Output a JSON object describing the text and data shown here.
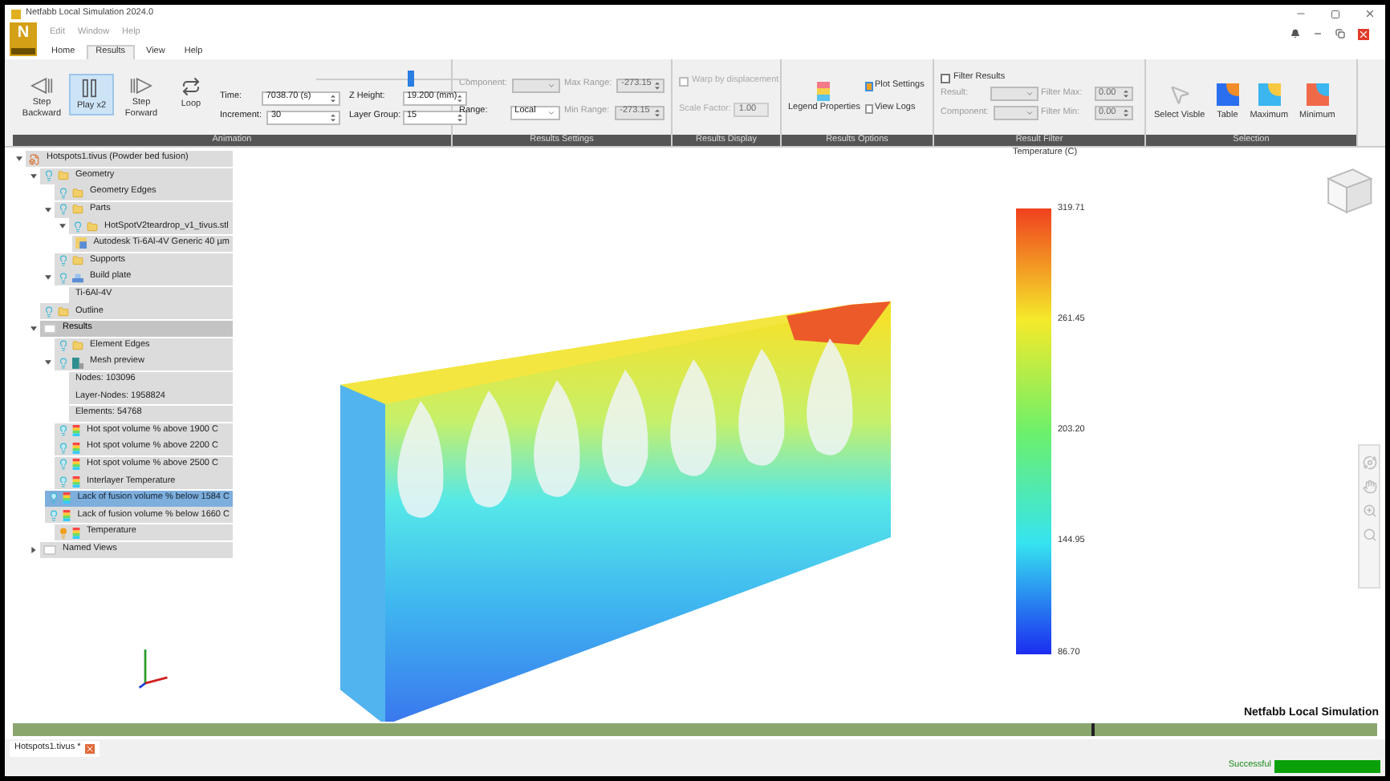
{
  "window": {
    "title": "Netfabb Local Simulation 2024.0"
  },
  "app_button": {
    "label": "N"
  },
  "menu": [
    "Edit",
    "Window",
    "Help"
  ],
  "tabs": [
    {
      "label": "Home",
      "selected": false
    },
    {
      "label": "Results",
      "selected": true
    },
    {
      "label": "View",
      "selected": false
    },
    {
      "label": "Help",
      "selected": false
    }
  ],
  "ribbon": {
    "animation": {
      "label": "Animation",
      "buttons": [
        {
          "label": "Step Backward",
          "kind": "back",
          "selected": false
        },
        {
          "label": "Play x2",
          "kind": "play",
          "selected": true
        },
        {
          "label": "Step Forward",
          "kind": "forward",
          "selected": false
        },
        {
          "label": "Loop",
          "kind": "loop",
          "selected": false
        }
      ],
      "slider": {
        "level": 0.62
      },
      "fields": [
        {
          "label": "Time:",
          "value": "7038.70 (s)"
        },
        {
          "label": "Z Height:",
          "value": "19.200 (mm)"
        },
        {
          "label": "Increment:",
          "value": "30"
        },
        {
          "label": "Layer Group:",
          "value": "15"
        }
      ]
    },
    "results_settings": {
      "label": "Results Settings",
      "fields": [
        {
          "label": "Component:",
          "kind": "select",
          "disabled": true
        },
        {
          "label": "Max Range:",
          "value": "-273.15",
          "kind": "spin",
          "disabled": true
        },
        {
          "label": "Range:",
          "value": "Local",
          "kind": "select",
          "disabled": false
        },
        {
          "label": "Min Range:",
          "value": "-273.15",
          "kind": "spin",
          "disabled": true
        }
      ]
    },
    "results_display": {
      "label": "Results Display",
      "warp": {
        "label": "Warp by displacement",
        "checked": false
      },
      "scale": {
        "label": "Scale Factor:",
        "value": "1.00"
      }
    },
    "results_options": {
      "label": "Results Options",
      "buttons": [
        {
          "label": "Legend Properties",
          "kind": "large"
        },
        {
          "label": "Plot Settings",
          "kind": "small"
        },
        {
          "label": "View Logs",
          "kind": "small"
        }
      ]
    },
    "result_filter": {
      "label": "Result Filter",
      "filter": {
        "label": "Filter Results",
        "checked": false
      },
      "fields": [
        {
          "label": "Result:",
          "kind": "select"
        },
        {
          "label": "Filter Max:",
          "value": "0.00",
          "kind": "spin"
        },
        {
          "label": "Component:",
          "kind": "select"
        },
        {
          "label": "Filter Min:",
          "value": "0.00",
          "kind": "spin"
        }
      ]
    },
    "selection": {
      "label": "Selection",
      "buttons": [
        {
          "label": "Select Visble",
          "kind": "cursor"
        },
        {
          "label": "Table",
          "kind": "table"
        },
        {
          "label": "Maximum",
          "kind": "maximum"
        },
        {
          "label": "Minimum",
          "kind": "minimum"
        }
      ]
    }
  },
  "tree": [
    {
      "label": "Hotspots1.tivus (Powder bed fusion)",
      "kind": "file",
      "expanded": true,
      "selected": false,
      "children": [
        {
          "label": "Geometry",
          "kind": "folder",
          "expanded": true,
          "selected": false,
          "children": [
            {
              "label": "Geometry Edges",
              "kind": "folder",
              "selected": false
            },
            {
              "label": "Parts",
              "kind": "folder",
              "expanded": true,
              "selected": false,
              "children": [
                {
                  "label": "HotSpotV2teardrop_v1_tivus.stl",
                  "kind": "folder",
                  "expanded": true,
                  "selected": false,
                  "children": [
                    {
                      "label": "Autodesk Ti-6Al-4V Generic 40 µm",
                      "kind": "material",
                      "selected": false
                    }
                  ]
                }
              ]
            },
            {
              "label": "Supports",
              "kind": "folder",
              "selected": false
            },
            {
              "label": "Build plate",
              "kind": "plate",
              "expanded": true,
              "selected": false,
              "children": [
                {
                  "label": "Ti-6Al-4V",
                  "kind": "property",
                  "selected": false
                }
              ]
            }
          ]
        },
        {
          "label": "Outline",
          "kind": "folder",
          "selected": false
        },
        {
          "label": "Results",
          "kind": "category",
          "expanded": true,
          "selected": false,
          "children": [
            {
              "label": "Element Edges",
              "kind": "folder",
              "selected": false
            },
            {
              "label": "Mesh preview",
              "kind": "mesh",
              "expanded": true,
              "selected": false,
              "children": [
                {
                  "label": "Nodes: 103096",
                  "kind": "property",
                  "selected": false
                },
                {
                  "label": "Layer-Nodes: 1958824",
                  "kind": "property",
                  "selected": false
                },
                {
                  "label": "Elements: 54768",
                  "kind": "property",
                  "selected": false
                }
              ]
            },
            {
              "label": "Hot spot volume % above 1900 C",
              "kind": "result",
              "active": false,
              "selected": false
            },
            {
              "label": "Hot spot volume % above 2200 C",
              "kind": "result",
              "active": false,
              "selected": false
            },
            {
              "label": "Hot spot volume % above 2500 C",
              "kind": "result",
              "active": false,
              "selected": false
            },
            {
              "label": "Interlayer Temperature",
              "kind": "result",
              "active": false,
              "selected": false
            },
            {
              "label": "Lack of fusion volume % below 1584 C",
              "kind": "result",
              "active": false,
              "selected": true
            },
            {
              "label": "Lack of fusion volume % below 1660 C",
              "kind": "result",
              "active": false,
              "selected": false
            },
            {
              "label": "Temperature",
              "kind": "result",
              "active": true,
              "selected": false
            }
          ]
        },
        {
          "label": "Named Views",
          "kind": "category",
          "expanded": false,
          "selected": false
        }
      ]
    }
  ],
  "legend": {
    "title": "Temperature (C)",
    "labels": [
      "319.71",
      "261.45",
      "203.20",
      "144.95",
      "86.70"
    ]
  },
  "viewport_label": "Netfabb Local Simulation",
  "timeline": {
    "level": 0.79
  },
  "document_tabs": [
    {
      "label": "Hotspots1.tivus *",
      "selected": true
    }
  ],
  "status": {
    "text": "Successful",
    "level": 1
  }
}
